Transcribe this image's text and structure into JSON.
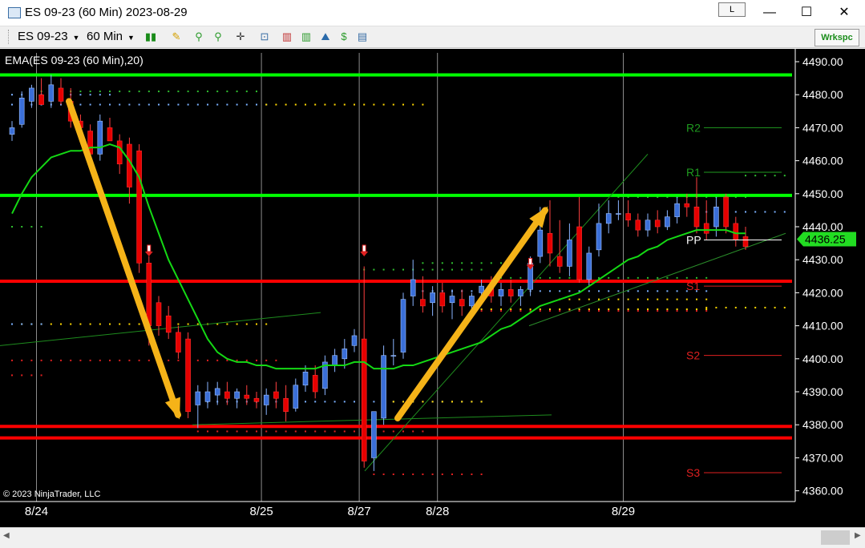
{
  "window": {
    "title": "ES 09-23 (60 Min)  2023-08-29",
    "l_button": "L",
    "minimize": "—",
    "maximize": "☐",
    "close": "✕"
  },
  "toolbar": {
    "instrument": "ES 09-23",
    "interval": "60 Min",
    "workspace_button": "Wrkspc"
  },
  "chart_data": {
    "type": "candlestick",
    "indicator_label": "EMA(ES 09-23 (60 Min),20)",
    "copyright": "© 2023 NinjaTrader, LLC",
    "current_price": "4436.25",
    "y_ticks": [
      "4490.00",
      "4480.00",
      "4470.00",
      "4460.00",
      "4450.00",
      "4440.00",
      "4430.00",
      "4420.00",
      "4410.00",
      "4400.00",
      "4390.00",
      "4380.00",
      "4370.00",
      "4360.00"
    ],
    "ylim": [
      4358,
      4495
    ],
    "x_labels": [
      {
        "label": "8/24",
        "index": 2
      },
      {
        "label": "8/25",
        "index": 25
      },
      {
        "label": "8/27",
        "index": 35
      },
      {
        "label": "8/28",
        "index": 43
      },
      {
        "label": "8/29",
        "index": 62
      }
    ],
    "candles": [
      {
        "o": 4468,
        "h": 4472,
        "l": 4466,
        "c": 4470
      },
      {
        "o": 4471,
        "h": 4481,
        "l": 4470,
        "c": 4479
      },
      {
        "o": 4478,
        "h": 4483,
        "l": 4476,
        "c": 4482
      },
      {
        "o": 4480,
        "h": 4485,
        "l": 4478,
        "c": 4477
      },
      {
        "o": 4478,
        "h": 4486,
        "l": 4476,
        "c": 4483
      },
      {
        "o": 4482,
        "h": 4485,
        "l": 4477,
        "c": 4478
      },
      {
        "o": 4478,
        "h": 4482,
        "l": 4470,
        "c": 4472
      },
      {
        "o": 4472,
        "h": 4474,
        "l": 4468,
        "c": 4470
      },
      {
        "o": 4469,
        "h": 4471,
        "l": 4460,
        "c": 4462
      },
      {
        "o": 4462,
        "h": 4474,
        "l": 4460,
        "c": 4472
      },
      {
        "o": 4470,
        "h": 4473,
        "l": 4466,
        "c": 4466
      },
      {
        "o": 4466,
        "h": 4468,
        "l": 4456,
        "c": 4459
      },
      {
        "o": 4465,
        "h": 4467,
        "l": 4447,
        "c": 4452
      },
      {
        "o": 4463,
        "h": 4465,
        "l": 4426,
        "c": 4429
      },
      {
        "o": 4429,
        "h": 4431,
        "l": 4404,
        "c": 4410
      },
      {
        "o": 4417,
        "h": 4419,
        "l": 4407,
        "c": 4410
      },
      {
        "o": 4413,
        "h": 4416,
        "l": 4406,
        "c": 4408
      },
      {
        "o": 4408,
        "h": 4410,
        "l": 4400,
        "c": 4402
      },
      {
        "o": 4406,
        "h": 4408,
        "l": 4382,
        "c": 4384
      },
      {
        "o": 4386,
        "h": 4392,
        "l": 4379,
        "c": 4390
      },
      {
        "o": 4387,
        "h": 4393,
        "l": 4385,
        "c": 4390
      },
      {
        "o": 4389,
        "h": 4393,
        "l": 4386,
        "c": 4391
      },
      {
        "o": 4390,
        "h": 4393,
        "l": 4386,
        "c": 4388
      },
      {
        "o": 4388,
        "h": 4391,
        "l": 4385,
        "c": 4390
      },
      {
        "o": 4389,
        "h": 4392,
        "l": 4386,
        "c": 4388
      },
      {
        "o": 4388,
        "h": 4390,
        "l": 4385,
        "c": 4387
      },
      {
        "o": 4386,
        "h": 4391,
        "l": 4383,
        "c": 4389
      },
      {
        "o": 4390,
        "h": 4393,
        "l": 4385,
        "c": 4388
      },
      {
        "o": 4388,
        "h": 4392,
        "l": 4381,
        "c": 4384
      },
      {
        "o": 4385,
        "h": 4394,
        "l": 4384,
        "c": 4392
      },
      {
        "o": 4392,
        "h": 4398,
        "l": 4390,
        "c": 4396
      },
      {
        "o": 4395,
        "h": 4398,
        "l": 4388,
        "c": 4390
      },
      {
        "o": 4391,
        "h": 4401,
        "l": 4389,
        "c": 4399
      },
      {
        "o": 4398,
        "h": 4403,
        "l": 4396,
        "c": 4401
      },
      {
        "o": 4400,
        "h": 4406,
        "l": 4397,
        "c": 4403
      },
      {
        "o": 4404,
        "h": 4409,
        "l": 4402,
        "c": 4407
      },
      {
        "o": 4406,
        "h": 4428,
        "l": 4367,
        "c": 4369
      },
      {
        "o": 4370,
        "h": 4384,
        "l": 4366,
        "c": 4384
      },
      {
        "o": 4382,
        "h": 4404,
        "l": 4380,
        "c": 4401
      },
      {
        "o": 4401,
        "h": 4406,
        "l": 4398,
        "c": 4401
      },
      {
        "o": 4402,
        "h": 4420,
        "l": 4400,
        "c": 4418
      },
      {
        "o": 4419,
        "h": 4430,
        "l": 4416,
        "c": 4424
      },
      {
        "o": 4418,
        "h": 4425,
        "l": 4414,
        "c": 4416
      },
      {
        "o": 4417,
        "h": 4422,
        "l": 4413,
        "c": 4420
      },
      {
        "o": 4420,
        "h": 4423,
        "l": 4414,
        "c": 4416
      },
      {
        "o": 4417,
        "h": 4421,
        "l": 4412,
        "c": 4419
      },
      {
        "o": 4418,
        "h": 4421,
        "l": 4413,
        "c": 4416
      },
      {
        "o": 4416,
        "h": 4420,
        "l": 4414,
        "c": 4419
      },
      {
        "o": 4420,
        "h": 4424,
        "l": 4417,
        "c": 4422
      },
      {
        "o": 4422,
        "h": 4425,
        "l": 4417,
        "c": 4419
      },
      {
        "o": 4419,
        "h": 4423,
        "l": 4416,
        "c": 4421
      },
      {
        "o": 4421,
        "h": 4424,
        "l": 4417,
        "c": 4419
      },
      {
        "o": 4419,
        "h": 4422,
        "l": 4416,
        "c": 4421
      },
      {
        "o": 4421,
        "h": 4431,
        "l": 4419,
        "c": 4429
      },
      {
        "o": 4431,
        "h": 4446,
        "l": 4429,
        "c": 4439
      },
      {
        "o": 4438,
        "h": 4448,
        "l": 4428,
        "c": 4432
      },
      {
        "o": 4431,
        "h": 4442,
        "l": 4426,
        "c": 4428
      },
      {
        "o": 4428,
        "h": 4441,
        "l": 4425,
        "c": 4436
      },
      {
        "o": 4440,
        "h": 4449,
        "l": 4423,
        "c": 4424
      },
      {
        "o": 4424,
        "h": 4434,
        "l": 4422,
        "c": 4432
      },
      {
        "o": 4433,
        "h": 4447,
        "l": 4431,
        "c": 4441
      },
      {
        "o": 4441,
        "h": 4448,
        "l": 4438,
        "c": 4444
      },
      {
        "o": 4444,
        "h": 4448,
        "l": 4442,
        "c": 4444
      },
      {
        "o": 4444,
        "h": 4448,
        "l": 4440,
        "c": 4442
      },
      {
        "o": 4442,
        "h": 4444,
        "l": 4437,
        "c": 4439
      },
      {
        "o": 4439,
        "h": 4444,
        "l": 4437,
        "c": 4442
      },
      {
        "o": 4442,
        "h": 4445,
        "l": 4438,
        "c": 4440
      },
      {
        "o": 4440,
        "h": 4445,
        "l": 4439,
        "c": 4443
      },
      {
        "o": 4443,
        "h": 4449,
        "l": 4441,
        "c": 4447
      },
      {
        "o": 4447,
        "h": 4450,
        "l": 4443,
        "c": 4446
      },
      {
        "o": 4446,
        "h": 4455,
        "l": 4438,
        "c": 4440
      },
      {
        "o": 4441,
        "h": 4448,
        "l": 4436,
        "c": 4438
      },
      {
        "o": 4440,
        "h": 4449,
        "l": 4437,
        "c": 4446
      },
      {
        "o": 4449,
        "h": 4450,
        "l": 4438,
        "c": 4440
      },
      {
        "o": 4441,
        "h": 4443,
        "l": 4434,
        "c": 4436
      },
      {
        "o": 4437,
        "h": 4440,
        "l": 4433,
        "c": 4434
      }
    ],
    "ema_20": [
      4444,
      4450,
      4455,
      4458,
      4461,
      4462,
      4463,
      4463,
      4464,
      4464,
      4465,
      4464,
      4460,
      4455,
      4446,
      4438,
      4430,
      4424,
      4418,
      4412,
      4406,
      4402,
      4400,
      4399,
      4399,
      4398,
      4398,
      4397,
      4397,
      4397,
      4397,
      4397,
      4398,
      4398,
      4398,
      4399,
      4399,
      4397,
      4397,
      4397,
      4398,
      4398,
      4399,
      4400,
      4401,
      4402,
      4403,
      4404,
      4405,
      4407,
      4409,
      4410,
      4412,
      4414,
      4416,
      4417,
      4418,
      4419,
      4420,
      4422,
      4424,
      4426,
      4428,
      4430,
      4431,
      4433,
      4434,
      4436,
      4437,
      4438,
      4439,
      4439,
      4439,
      4439,
      4438,
      4438
    ],
    "horizontal_lines": [
      {
        "name": "green-resistance-high",
        "price": 4486,
        "color": "#00ff00"
      },
      {
        "name": "green-resistance-mid",
        "price": 4449.5,
        "color": "#00ff00"
      },
      {
        "name": "red-support-1",
        "price": 4423.5,
        "color": "#ff0000"
      },
      {
        "name": "red-support-2",
        "price": 4379.5,
        "color": "#ff0000"
      },
      {
        "name": "red-support-3",
        "price": 4376,
        "color": "#ff0000"
      }
    ],
    "pivot_levels": [
      {
        "label": "R2",
        "price": 4470,
        "color": "#1f9a1f"
      },
      {
        "label": "R1",
        "price": 4456.5,
        "color": "#1f9a1f"
      },
      {
        "label": "PP",
        "price": 4436,
        "color": "#ffffff"
      },
      {
        "label": "S1",
        "price": 4422,
        "color": "#e02020"
      },
      {
        "label": "S2",
        "price": 4401,
        "color": "#e02020"
      },
      {
        "label": "S3",
        "price": 4365.5,
        "color": "#e02020"
      }
    ],
    "colors": {
      "up_candle": "#3b6fd8",
      "up_candle_outline": "#66a0ff",
      "down_candle": "#e60000",
      "ema": "#14d914",
      "arrow": "#f5b318",
      "grid": "#8c8c8c",
      "price_badge": "#22dd22"
    }
  }
}
